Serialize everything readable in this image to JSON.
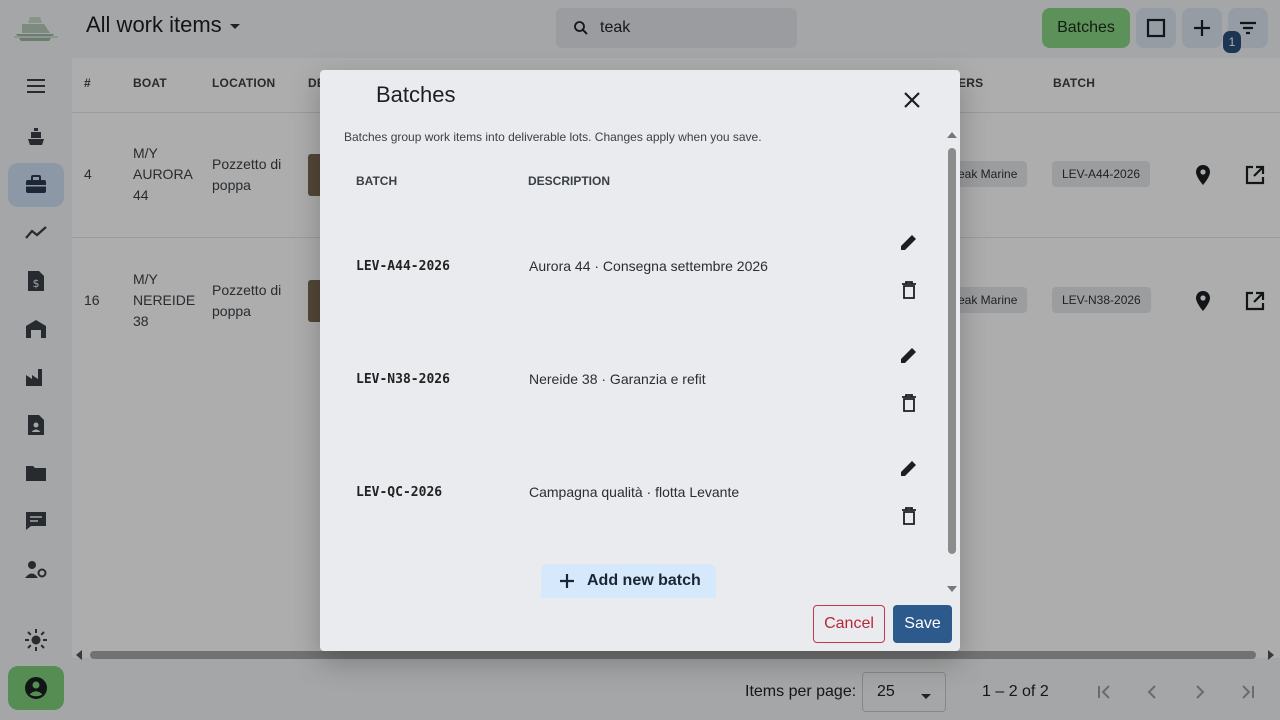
{
  "header": {
    "title": "All work items",
    "search_value": "teak",
    "batches_button": "Batches",
    "filter_badge": "1"
  },
  "table": {
    "columns": [
      "#",
      "BOAT",
      "LOCATION",
      "DE",
      "ERS",
      "BATCH"
    ],
    "rows": [
      {
        "num": "4",
        "boat_line1": "M/Y",
        "boat_line2": "AURORA",
        "boat_line3": "44",
        "location_line1": "Pozzetto di",
        "location_line2": "poppa",
        "owner": "eak Marine",
        "batch": "LEV-A44-2026"
      },
      {
        "num": "16",
        "boat_line1": "M/Y",
        "boat_line2": "NEREIDE",
        "boat_line3": "38",
        "location_line1": "Pozzetto di",
        "location_line2": "poppa",
        "owner": "eak Marine",
        "batch": "LEV-N38-2026"
      }
    ]
  },
  "pager": {
    "items_per_page_label": "Items per page:",
    "items_per_page_value": "25",
    "range": "1 – 2 of 2"
  },
  "dialog": {
    "title": "Batches",
    "description": "Batches group work items into deliverable lots. Changes apply when you save.",
    "col_batch": "BATCH",
    "col_description": "DESCRIPTION",
    "batches": [
      {
        "code": "LEV-A44-2026",
        "description": "Aurora 44 · Consegna settembre 2026"
      },
      {
        "code": "LEV-N38-2026",
        "description": "Nereide 38 · Garanzia e refit"
      },
      {
        "code": "LEV-QC-2026",
        "description": "Campagna qualità · flotta Levante"
      }
    ],
    "add_button": "Add new batch",
    "cancel_button": "Cancel",
    "save_button": "Save"
  },
  "colors": {
    "accent_green": "#88d884",
    "primary_blue": "#2d5a8c",
    "danger_red": "#b5283b"
  }
}
